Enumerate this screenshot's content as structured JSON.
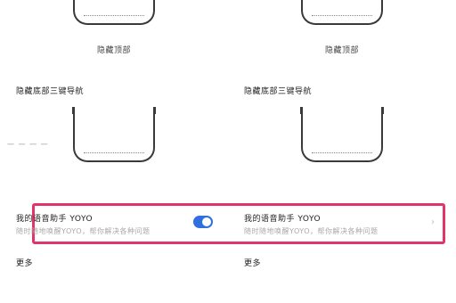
{
  "top_captions": {
    "left": "隐藏顶部",
    "right": "隐藏顶部"
  },
  "section_headings": {
    "left": "隐藏底部三键导航",
    "right": "隐藏底部三键导航"
  },
  "side_hint": "一 一 一 一",
  "voice_assistant": {
    "left_title": "我的语音助手 YOYO",
    "left_desc": "随时随地唤醒YOYO，帮你解决各种问题",
    "right_title": "我的语音助手 YOYO",
    "right_desc": "随时随地唤醒YOYO，帮你解决各种问题",
    "toggle_on": true
  },
  "more": {
    "left": "更多",
    "right": "更多"
  },
  "colors": {
    "highlight_border": "#e0356b",
    "toggle_on": "#2f6fe0"
  }
}
